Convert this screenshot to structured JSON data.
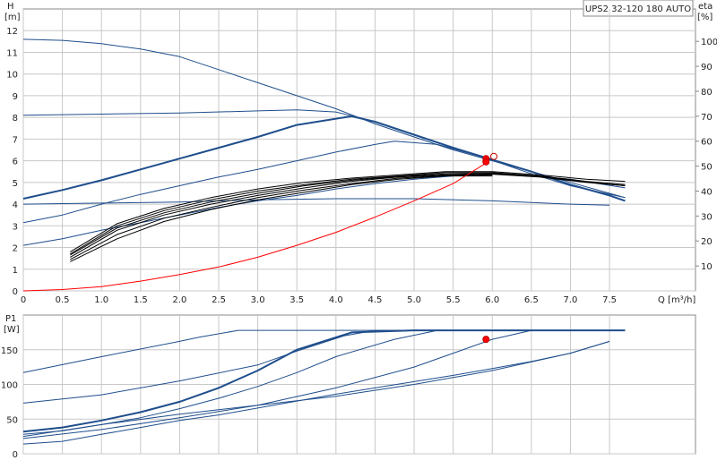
{
  "chart_data": [
    {
      "type": "line",
      "title": "UPS2 32-120 180 AUTO",
      "xlabel": "Q [m³/h]",
      "ylabel_left_line1": "H",
      "ylabel_left_line2": "[m]",
      "ylabel_right_line1": "eta",
      "ylabel_right_line2": "[%]",
      "xlim": [
        0,
        8.6
      ],
      "ylim": [
        0,
        13
      ],
      "ylim_right": [
        0,
        113
      ],
      "x_ticks": [
        "0",
        "0.5",
        "1.0",
        "1.5",
        "2.0",
        "2.5",
        "3.0",
        "3.5",
        "4.0",
        "4.5",
        "5.0",
        "5.5",
        "6.0",
        "6.5",
        "7.0",
        "7.5"
      ],
      "y_ticks": [
        "0",
        "1",
        "2",
        "3",
        "4",
        "5",
        "6",
        "7",
        "8",
        "9",
        "10",
        "11",
        "12"
      ],
      "y_ticks_right": [
        "10",
        "20",
        "30",
        "40",
        "50",
        "60",
        "70",
        "80",
        "90",
        "100"
      ],
      "grid": true,
      "colors": {
        "blue": "#1f4e8c",
        "black": "#000000",
        "red": "#ff0000",
        "grid": "#c8c8c8"
      },
      "series": [
        {
          "color": "blue",
          "width": 1,
          "values": [
            [
              0,
              11.6
            ],
            [
              0.5,
              11.55
            ],
            [
              1,
              11.4
            ],
            [
              1.5,
              11.15
            ],
            [
              2,
              10.8
            ],
            [
              2.5,
              10.2
            ],
            [
              3,
              9.6
            ],
            [
              3.5,
              9.0
            ],
            [
              4,
              8.4
            ],
            [
              4.5,
              7.7
            ],
            [
              5,
              7.1
            ],
            [
              5.5,
              6.5
            ],
            [
              6,
              6.0
            ],
            [
              6.5,
              5.5
            ],
            [
              7,
              5.0
            ],
            [
              7.5,
              4.5
            ],
            [
              7.7,
              4.3
            ]
          ]
        },
        {
          "color": "blue",
          "width": 1,
          "values": [
            [
              0,
              8.1
            ],
            [
              1,
              8.15
            ],
            [
              2,
              8.2
            ],
            [
              3,
              8.3
            ],
            [
              3.5,
              8.35
            ],
            [
              4,
              8.25
            ],
            [
              4.5,
              7.8
            ],
            [
              5,
              7.2
            ],
            [
              5.5,
              6.6
            ],
            [
              6,
              6.05
            ]
          ]
        },
        {
          "color": "blue",
          "width": 2,
          "values": [
            [
              0,
              4.25
            ],
            [
              0.5,
              4.65
            ],
            [
              1,
              5.1
            ],
            [
              1.5,
              5.6
            ],
            [
              2,
              6.1
            ],
            [
              2.5,
              6.6
            ],
            [
              3,
              7.1
            ],
            [
              3.5,
              7.65
            ],
            [
              4.2,
              8.05
            ],
            [
              4.5,
              7.8
            ],
            [
              5,
              7.2
            ],
            [
              5.5,
              6.6
            ],
            [
              6,
              6.05
            ],
            [
              6.5,
              5.5
            ],
            [
              7,
              4.9
            ],
            [
              7.5,
              4.4
            ],
            [
              7.7,
              4.15
            ]
          ]
        },
        {
          "color": "blue",
          "width": 1,
          "values": [
            [
              0,
              3.15
            ],
            [
              0.5,
              3.5
            ],
            [
              1,
              4.0
            ],
            [
              1.5,
              4.45
            ],
            [
              2,
              4.85
            ],
            [
              2.5,
              5.25
            ],
            [
              3,
              5.6
            ],
            [
              3.5,
              6.0
            ],
            [
              4,
              6.4
            ],
            [
              4.5,
              6.75
            ],
            [
              4.75,
              6.9
            ],
            [
              5.3,
              6.75
            ],
            [
              5.9,
              6.15
            ],
            [
              6.5,
              5.4
            ],
            [
              7,
              4.85
            ],
            [
              7.7,
              4.3
            ]
          ]
        },
        {
          "color": "blue",
          "width": 1,
          "values": [
            [
              0,
              2.1
            ],
            [
              0.5,
              2.4
            ],
            [
              1,
              2.8
            ],
            [
              1.5,
              3.15
            ],
            [
              2,
              3.5
            ],
            [
              2.5,
              3.85
            ],
            [
              3,
              4.15
            ],
            [
              3.5,
              4.4
            ],
            [
              4,
              4.7
            ],
            [
              4.5,
              4.95
            ],
            [
              5,
              5.15
            ],
            [
              5.5,
              5.3
            ],
            [
              6,
              5.4
            ],
            [
              6.5,
              5.3
            ],
            [
              7,
              5.15
            ],
            [
              7.7,
              4.75
            ]
          ]
        },
        {
          "color": "blue",
          "width": 1,
          "values": [
            [
              0,
              4.0
            ],
            [
              1,
              4.05
            ],
            [
              2,
              4.1
            ],
            [
              3,
              4.2
            ],
            [
              4,
              4.25
            ],
            [
              5,
              4.25
            ],
            [
              6,
              4.15
            ],
            [
              7,
              4.0
            ],
            [
              7.5,
              3.95
            ]
          ]
        },
        {
          "color": "black",
          "width": 1,
          "values": [
            [
              0.6,
              1.8
            ],
            [
              1.2,
              3.1
            ],
            [
              1.8,
              3.8
            ],
            [
              2.4,
              4.3
            ],
            [
              3,
              4.7
            ],
            [
              3.6,
              5.0
            ],
            [
              4.2,
              5.2
            ],
            [
              4.8,
              5.35
            ],
            [
              5.4,
              5.5
            ],
            [
              6,
              5.5
            ],
            [
              6.6,
              5.35
            ],
            [
              7.2,
              5.15
            ],
            [
              7.7,
              5.05
            ]
          ]
        },
        {
          "color": "black",
          "width": 1,
          "values": [
            [
              0.6,
              1.7
            ],
            [
              1.2,
              3.0
            ],
            [
              1.8,
              3.7
            ],
            [
              2.4,
              4.2
            ],
            [
              3,
              4.6
            ],
            [
              3.6,
              4.9
            ],
            [
              4.2,
              5.15
            ],
            [
              4.8,
              5.3
            ],
            [
              5.4,
              5.45
            ],
            [
              6,
              5.45
            ],
            [
              6.6,
              5.3
            ],
            [
              7.2,
              5.05
            ],
            [
              7.7,
              4.9
            ]
          ]
        },
        {
          "color": "black",
          "width": 1,
          "values": [
            [
              0.6,
              1.65
            ],
            [
              1.2,
              2.9
            ],
            [
              1.8,
              3.6
            ],
            [
              2.4,
              4.1
            ],
            [
              3,
              4.5
            ],
            [
              3.6,
              4.85
            ],
            [
              4.2,
              5.1
            ],
            [
              4.8,
              5.28
            ],
            [
              5.4,
              5.4
            ],
            [
              6,
              5.42
            ],
            [
              6.6,
              5.28
            ],
            [
              7.2,
              5.02
            ],
            [
              7.7,
              4.85
            ]
          ]
        },
        {
          "color": "black",
          "width": 1,
          "values": [
            [
              0.6,
              1.55
            ],
            [
              1.2,
              2.8
            ],
            [
              1.8,
              3.5
            ],
            [
              2.4,
              4.0
            ],
            [
              3,
              4.4
            ],
            [
              3.6,
              4.75
            ],
            [
              4.2,
              5.05
            ],
            [
              4.8,
              5.25
            ],
            [
              5.4,
              5.35
            ],
            [
              6,
              5.38
            ],
            [
              6.6,
              5.25
            ],
            [
              7.2,
              5.0
            ],
            [
              7.7,
              4.85
            ]
          ]
        },
        {
          "color": "black",
          "width": 1,
          "values": [
            [
              0.6,
              1.45
            ],
            [
              1.2,
              2.6
            ],
            [
              1.8,
              3.35
            ],
            [
              2.4,
              3.85
            ],
            [
              3,
              4.3
            ],
            [
              3.6,
              4.65
            ],
            [
              4.2,
              4.95
            ],
            [
              4.8,
              5.2
            ],
            [
              5.4,
              5.32
            ],
            [
              6,
              5.35
            ]
          ]
        },
        {
          "color": "black",
          "width": 1,
          "values": [
            [
              0.6,
              1.35
            ],
            [
              1.2,
              2.4
            ],
            [
              1.8,
              3.2
            ],
            [
              2.4,
              3.75
            ],
            [
              3,
              4.2
            ],
            [
              3.6,
              4.55
            ],
            [
              4.2,
              4.9
            ],
            [
              4.8,
              5.15
            ],
            [
              5.4,
              5.3
            ],
            [
              6,
              5.3
            ]
          ]
        },
        {
          "color": "red",
          "width": 1,
          "values": [
            [
              0,
              0
            ],
            [
              0.5,
              0.06
            ],
            [
              1,
              0.2
            ],
            [
              1.5,
              0.45
            ],
            [
              2,
              0.75
            ],
            [
              2.5,
              1.1
            ],
            [
              3,
              1.55
            ],
            [
              3.5,
              2.1
            ],
            [
              4,
              2.7
            ],
            [
              4.5,
              3.4
            ],
            [
              5,
              4.15
            ],
            [
              5.5,
              4.95
            ],
            [
              5.9,
              5.85
            ]
          ]
        }
      ],
      "markers": [
        {
          "x": 5.92,
          "y": 6.1,
          "fill": "#ff0000"
        },
        {
          "x": 5.92,
          "y": 5.95,
          "fill": "#ff0000"
        },
        {
          "x": 6.02,
          "y": 6.2,
          "fill": "#ffffff"
        }
      ]
    },
    {
      "type": "line",
      "xlabel": "",
      "ylabel_left_line1": "P1",
      "ylabel_left_line2": "[W]",
      "xlim": [
        0,
        8.6
      ],
      "ylim": [
        0,
        200
      ],
      "y_ticks": [
        "0",
        "50",
        "100",
        "150"
      ],
      "grid": true,
      "series": [
        {
          "color": "blue",
          "width": 1,
          "values": [
            [
              0,
              117
            ],
            [
              1,
              140
            ],
            [
              2,
              162
            ],
            [
              2.25,
              168
            ],
            [
              2.75,
              178
            ],
            [
              3.5,
              178
            ],
            [
              5,
              178
            ],
            [
              7.7,
              178
            ]
          ]
        },
        {
          "color": "blue",
          "width": 1,
          "values": [
            [
              0,
              73
            ],
            [
              1,
              85
            ],
            [
              2,
              105
            ],
            [
              3,
              128
            ],
            [
              3.5,
              148
            ],
            [
              4.1,
              170
            ],
            [
              4.5,
              178
            ],
            [
              7.7,
              178
            ]
          ]
        },
        {
          "color": "blue",
          "width": 2,
          "values": [
            [
              0,
              32
            ],
            [
              0.5,
              38
            ],
            [
              1,
              48
            ],
            [
              1.5,
              60
            ],
            [
              2,
              75
            ],
            [
              2.5,
              95
            ],
            [
              3,
              120
            ],
            [
              3.5,
              150
            ],
            [
              4.2,
              175
            ],
            [
              5,
              178
            ],
            [
              7.7,
              178
            ]
          ]
        },
        {
          "color": "blue",
          "width": 1,
          "values": [
            [
              0,
              28
            ],
            [
              0.5,
              33
            ],
            [
              1,
              42
            ],
            [
              1.5,
              52
            ],
            [
              2,
              65
            ],
            [
              2.5,
              80
            ],
            [
              3,
              97
            ],
            [
              3.5,
              117
            ],
            [
              4,
              140
            ],
            [
              4.75,
              165
            ],
            [
              5.3,
              178
            ],
            [
              7.7,
              178
            ]
          ]
        },
        {
          "color": "blue",
          "width": 1,
          "values": [
            [
              0,
              22
            ],
            [
              1,
              35
            ],
            [
              2,
              52
            ],
            [
              3,
              70
            ],
            [
              4,
              95
            ],
            [
              5,
              125
            ],
            [
              5.5,
              145
            ],
            [
              6,
              165
            ],
            [
              6.5,
              178
            ],
            [
              7.7,
              178
            ]
          ]
        },
        {
          "color": "blue",
          "width": 1,
          "values": [
            [
              0,
              14
            ],
            [
              0.5,
              18
            ],
            [
              1,
              28
            ],
            [
              1.5,
              38
            ],
            [
              2,
              48
            ],
            [
              2.5,
              56
            ],
            [
              3,
              66
            ],
            [
              3.5,
              76
            ],
            [
              4,
              86
            ],
            [
              4.5,
              95
            ],
            [
              5,
              104
            ],
            [
              5.5,
              113
            ],
            [
              6,
              123
            ],
            [
              6.5,
              133
            ],
            [
              7,
              145
            ],
            [
              7.5,
              162
            ]
          ]
        },
        {
          "color": "blue",
          "width": 1,
          "values": [
            [
              0,
              25
            ],
            [
              1,
              42
            ],
            [
              2,
              57
            ],
            [
              3,
              70
            ],
            [
              4,
              83
            ],
            [
              5,
              100
            ],
            [
              6,
              120
            ],
            [
              7,
              145
            ],
            [
              7.5,
              162
            ]
          ]
        }
      ],
      "markers": [
        {
          "x": 5.92,
          "y": 165,
          "fill": "#ff0000"
        }
      ]
    }
  ]
}
